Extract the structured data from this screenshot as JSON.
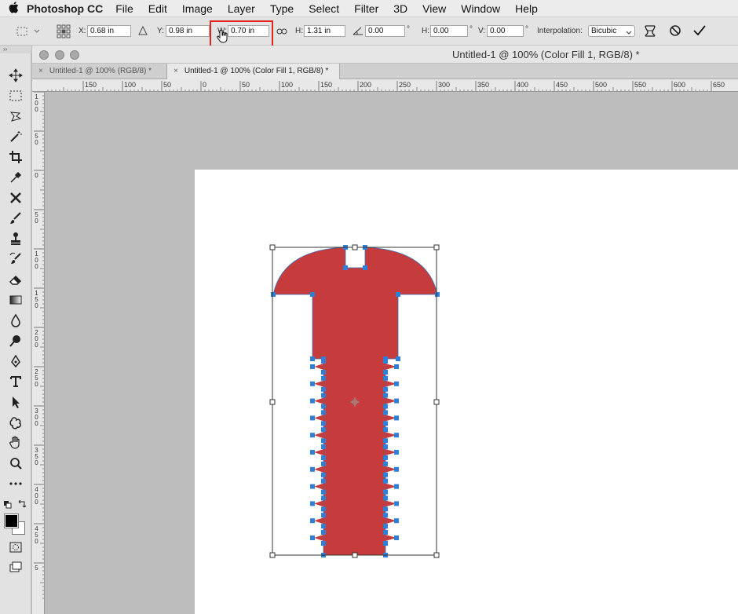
{
  "menu": {
    "apple": "",
    "app_name": "Photoshop CC",
    "items": [
      "File",
      "Edit",
      "Image",
      "Layer",
      "Type",
      "Select",
      "Filter",
      "3D",
      "View",
      "Window",
      "Help"
    ]
  },
  "options": {
    "x_label": "X:",
    "x_value": "0.68 in",
    "y_label": "Y:",
    "y_value": "0.98 in",
    "w_label": "W:",
    "w_value": "0.70 in",
    "h_label": "H:",
    "h_value": "1.31 in",
    "angle_value": "0.00",
    "hskew_label": "H:",
    "hskew_value": "0.00",
    "vskew_label": "V:",
    "vskew_value": "0.00",
    "degree_symbol": "°",
    "interpolation_label": "Interpolation:",
    "interpolation_value": "Bicubic",
    "highlight_color": "#e0231f"
  },
  "panel": {
    "collapse": "››"
  },
  "document": {
    "window_title": "Untitled-1 @ 100% (Color Fill 1, RGB/8) *",
    "tabs": [
      {
        "label": "Untitled-1 @ 100% (RGB/8) *",
        "active": false
      },
      {
        "label": "Untitled-1 @ 100% (Color Fill 1, RGB/8) *",
        "active": true
      }
    ],
    "close_glyph": "×"
  },
  "rulers": {
    "horizontal": [
      "150",
      "100",
      "50",
      "0",
      "50",
      "100",
      "150",
      "200",
      "250",
      "300",
      "350",
      "400",
      "450",
      "500",
      "550",
      "600",
      "650"
    ],
    "vertical": [
      "1 0 0",
      "5 0",
      "0",
      "5 0",
      "1 0 0",
      "1 5 0",
      "2 0 0",
      "2 5 0",
      "3 0 0",
      "3 5 0",
      "4 0 0",
      "4 5 0",
      "5"
    ]
  },
  "canvas": {
    "shape_color": "#c63b3b",
    "page_color": "#ffffff",
    "pasteboard_color": "#bdbdbd"
  },
  "colors": {
    "foreground": "#000000",
    "background": "#ffffff"
  }
}
